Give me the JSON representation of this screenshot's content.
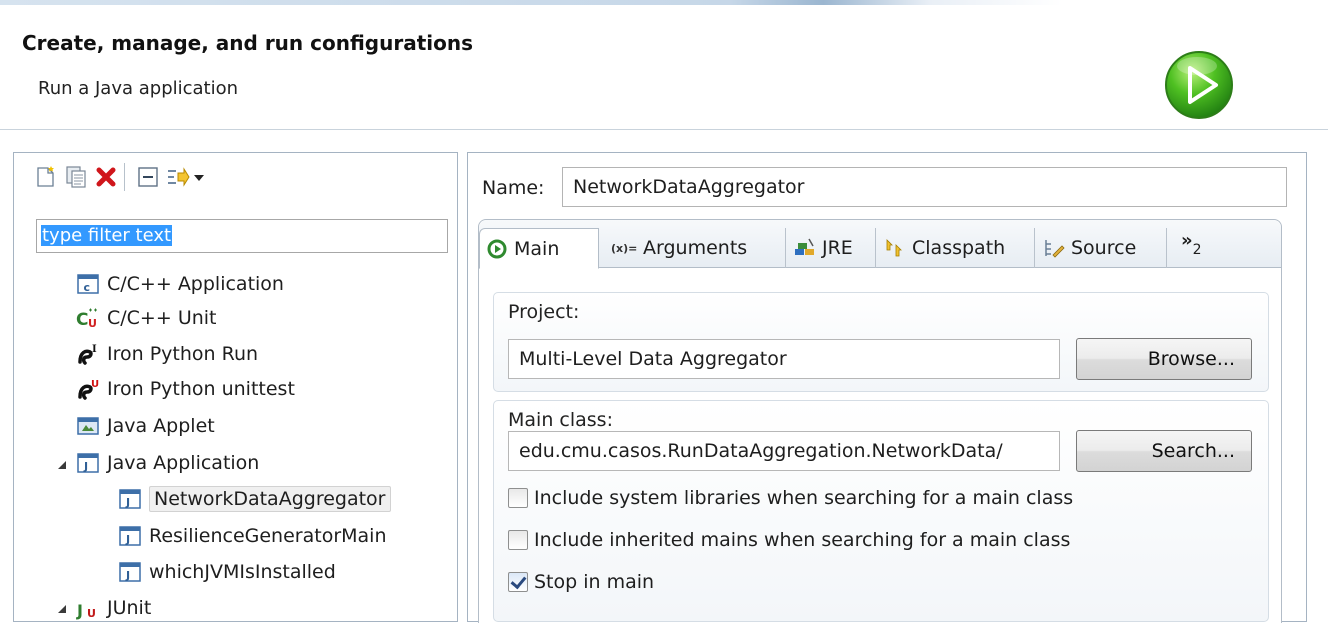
{
  "header": {
    "title": "Create, manage, and run configurations",
    "subtitle": "Run a Java application"
  },
  "left_panel": {
    "toolbar": {
      "icons": [
        "new-config-icon",
        "duplicate-icon",
        "delete-icon",
        "collapse-all-icon",
        "filter-icon",
        "dropdown-icon"
      ]
    },
    "filter": {
      "value": "type filter text"
    },
    "tree": [
      {
        "label": "C/C++ Application",
        "icon": "c-app-icon",
        "level": 1
      },
      {
        "label": "C/C++ Unit",
        "icon": "c-unit-icon",
        "level": 1
      },
      {
        "label": "Iron Python Run",
        "icon": "ironpython-run-icon",
        "level": 1
      },
      {
        "label": "Iron Python unittest",
        "icon": "ironpython-unittest-icon",
        "level": 1
      },
      {
        "label": "Java Applet",
        "icon": "java-applet-icon",
        "level": 1
      },
      {
        "label": "Java Application",
        "icon": "java-app-icon",
        "level": 1,
        "expanded": true
      },
      {
        "label": "NetworkDataAggregator",
        "icon": "java-config-icon",
        "level": 2,
        "selected": true
      },
      {
        "label": "ResilienceGeneratorMain",
        "icon": "java-config-icon",
        "level": 2
      },
      {
        "label": "whichJVMIsInstalled",
        "icon": "java-config-icon",
        "level": 2
      },
      {
        "label": "JUnit",
        "icon": "junit-icon",
        "level": 1,
        "expanded": true
      }
    ]
  },
  "right_panel": {
    "name_label": "Name:",
    "name_value": "NetworkDataAggregator",
    "tabs": [
      {
        "label": "Main",
        "icon": "main-tab-icon",
        "active": true
      },
      {
        "label": "Arguments",
        "icon": "arguments-tab-icon"
      },
      {
        "label": "JRE",
        "icon": "jre-tab-icon"
      },
      {
        "label": "Classpath",
        "icon": "classpath-tab-icon"
      },
      {
        "label": "Source",
        "icon": "source-tab-icon"
      }
    ],
    "overflow_tabs": {
      "glyph": "»",
      "count": "2"
    },
    "project": {
      "label": "Project:",
      "value": "Multi-Level Data Aggregator",
      "button": "Browse..."
    },
    "main_class": {
      "label": "Main class:",
      "value": "edu.cmu.casos.RunDataAggregation.NetworkData/",
      "button": "Search..."
    },
    "options": [
      {
        "label": "Include system libraries when searching for a main class",
        "checked": false
      },
      {
        "label": "Include inherited mains when searching for a main class",
        "checked": false
      },
      {
        "label": "Stop in main",
        "checked": true
      }
    ]
  }
}
